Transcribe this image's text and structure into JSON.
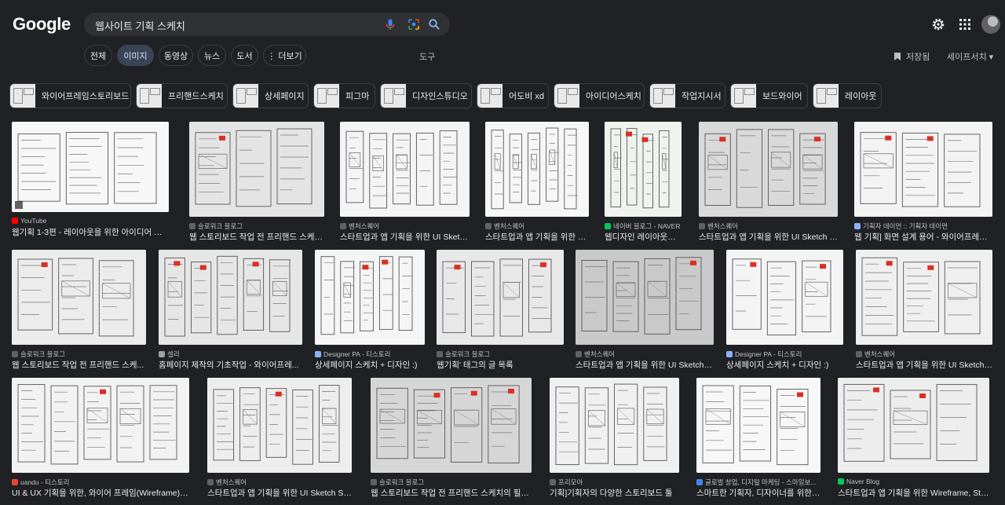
{
  "header": {
    "logo": "Google",
    "search_query": "웹사이트 기획 스케치"
  },
  "filters": {
    "tabs": [
      {
        "label": "전체",
        "active": false
      },
      {
        "label": "이미지",
        "active": true
      },
      {
        "label": "동영상",
        "active": false
      },
      {
        "label": "뉴스",
        "active": false
      },
      {
        "label": "도서",
        "active": false
      },
      {
        "label": "⋮ 더보기",
        "active": false
      }
    ],
    "tools": "도구",
    "saved": "저장됨",
    "safesearch": "세이프서치 ▾"
  },
  "suggestions": [
    "와이어프레임스토리보드",
    "프리핸드스케치",
    "상세페이지",
    "피그마",
    "디자인스튜디오",
    "어도비 xd",
    "아이디어스케치",
    "작업지시서",
    "보드와이어",
    "레이아웃"
  ],
  "results": [
    {
      "source": "YouTube",
      "title": "웹기획 1-3편 - 레이아웃을 위한 아이디어 스케...",
      "favicon_color": "#ff0000"
    },
    {
      "source": "슬로워크 블로그",
      "title": "웹 스토리보드 작업 전 프리핸드 스케치...",
      "favicon_color": "#5f6368"
    },
    {
      "source": "벤처스퀘어",
      "title": "스타트업과 앱 기획을 위한 UI Sketch ...",
      "favicon_color": "#5f6368"
    },
    {
      "source": "벤처스퀘어",
      "title": "스타트업과 앱 기획을 위한 UI ...",
      "favicon_color": "#5f6368"
    },
    {
      "source": "네이버 블로그 - NAVER",
      "title": "웹디자인 레이아웃과 ...",
      "favicon_color": "#03c75a"
    },
    {
      "source": "벤처스퀘어",
      "title": "스타트업과 앱 기획을 위한 UI Sketch Sh...",
      "favicon_color": "#5f6368"
    },
    {
      "source": "기획자 데이먼 :: 기획자 데이먼",
      "title": "웹 기획] 화면 설계 용어 - 와이어프레임, ...",
      "favicon_color": "#8ab4f8"
    },
    {
      "source": "슬로워크 블로그",
      "title": "웹 스토리보드 작업 전 프리핸드 스케...",
      "favicon_color": "#5f6368"
    },
    {
      "source": "셀리",
      "title": "홈페이지 제작의 기초작업 - 와이어프레...",
      "favicon_color": "#9aa0a6"
    },
    {
      "source": "Designer PA - 티스토리",
      "title": "상세페이지 스케치 + 디자인 :)",
      "favicon_color": "#8ab4f8"
    },
    {
      "source": "슬로워크 블로그",
      "title": "웹기획' 태그의 글 목록",
      "favicon_color": "#5f6368"
    },
    {
      "source": "벤처스퀘어",
      "title": "스타트업과 앱 기획을 위한 UI Sketch S...",
      "favicon_color": "#5f6368"
    },
    {
      "source": "Designer PA - 티스토리",
      "title": "상세페이지 스케치 + 디자인 :)",
      "favicon_color": "#8ab4f8"
    },
    {
      "source": "벤처스퀘어",
      "title": "스타트업과 앱 기획을 위한 UI Sketch S...",
      "favicon_color": "#5f6368"
    },
    {
      "source": "uandu - 티스토리",
      "title": "UI & UX 기획을 위한, 와이어 프레임(Wireframe) & 프...",
      "favicon_color": "#ea4335"
    },
    {
      "source": "벤처스퀘어",
      "title": "스타트업과 앱 기획을 위한 UI Sketch Sheet",
      "favicon_color": "#5f6368"
    },
    {
      "source": "슬로워크 블로그",
      "title": "웹 스토리보드 작업 전 프리핸드 스케치의 필요성",
      "favicon_color": "#5f6368"
    },
    {
      "source": "프리모아",
      "title": "기획]기획자의 다양한 스토리보드 툴",
      "favicon_color": "#5f6368"
    },
    {
      "source": "글로벌 창업, 디지털 마케팅 - 스마일보...",
      "title": "스마트한 기획자, 디자이너를 위한 ...",
      "favicon_color": "#4285f4"
    },
    {
      "source": "Naver Blog",
      "title": "스타트업과 앱 기획을 위한 Wireframe, Story...",
      "favicon_color": "#03c75a"
    }
  ]
}
